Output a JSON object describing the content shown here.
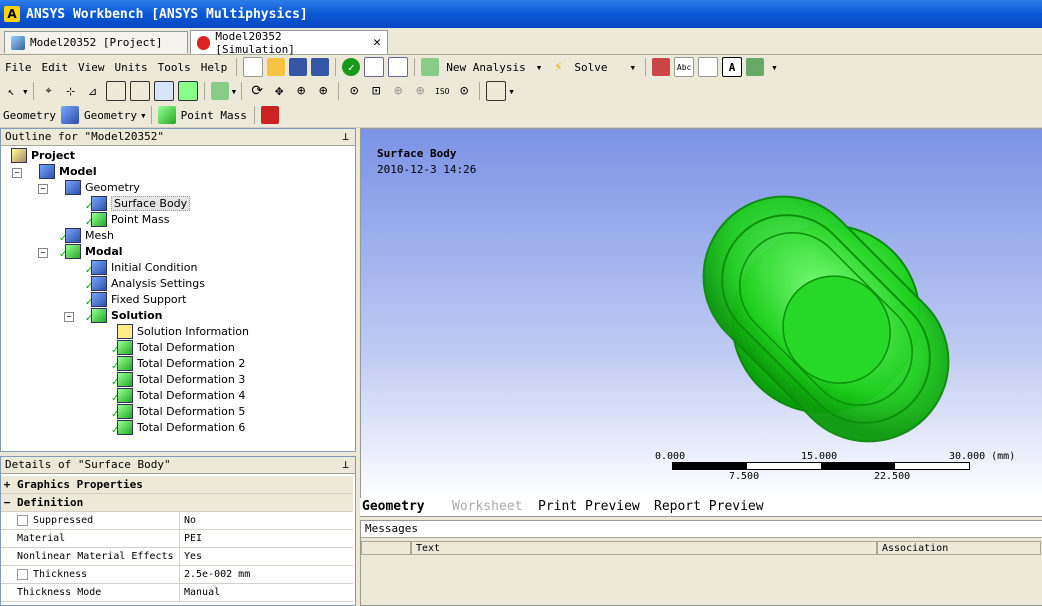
{
  "window": {
    "title": "ANSYS Workbench [ANSYS Multiphysics]"
  },
  "tabs": [
    {
      "label": "Model20352 [Project]"
    },
    {
      "label": "Model20352 [Simulation]"
    }
  ],
  "menu": [
    "File",
    "Edit",
    "View",
    "Units",
    "Tools",
    "Help"
  ],
  "toolbar1": {
    "new_analysis_label": "New Analysis",
    "solve_label": "Solve"
  },
  "toolbar3": {
    "geometry_label": "Geometry",
    "geometry_dropdown_label": "Geometry",
    "point_mass_label": "Point Mass"
  },
  "outline": {
    "header": "Outline for \"Model20352\"",
    "tree": [
      "Project",
      "Model",
      "Geometry",
      "Surface Body",
      "Point Mass",
      "Mesh",
      "Modal",
      "Initial Condition",
      "Analysis Settings",
      "Fixed Support",
      "Solution",
      "Solution Information",
      "Total Deformation",
      "Total Deformation 2",
      "Total Deformation 3",
      "Total Deformation 4",
      "Total Deformation 5",
      "Total Deformation 6"
    ]
  },
  "details": {
    "header": "Details of \"Surface Body\"",
    "group_graphics": "Graphics Properties",
    "group_definition": "Definition",
    "rows": [
      {
        "k": "Suppressed",
        "v": "No"
      },
      {
        "k": "Material",
        "v": "PEI"
      },
      {
        "k": "Nonlinear Material Effects",
        "v": "Yes"
      },
      {
        "k": "Thickness",
        "v": "2.5e-002 mm"
      },
      {
        "k": "Thickness Mode",
        "v": "Manual"
      }
    ]
  },
  "viewport": {
    "title": "Surface Body",
    "date": "2010-12-3 14:26",
    "scale_top": [
      "0.000",
      "15.000",
      "30.000 (mm)"
    ],
    "scale_bottom": [
      "7.500",
      "22.500"
    ]
  },
  "view_tabs": [
    "Geometry",
    "Worksheet",
    "Print Preview",
    "Report Preview"
  ],
  "messages": {
    "header": "Messages",
    "col_text": "Text",
    "col_assoc": "Association"
  },
  "colors": {
    "titlebar": "#0a58d6",
    "model_green": "#22cc22",
    "viewport_top": "#7b93e6"
  }
}
